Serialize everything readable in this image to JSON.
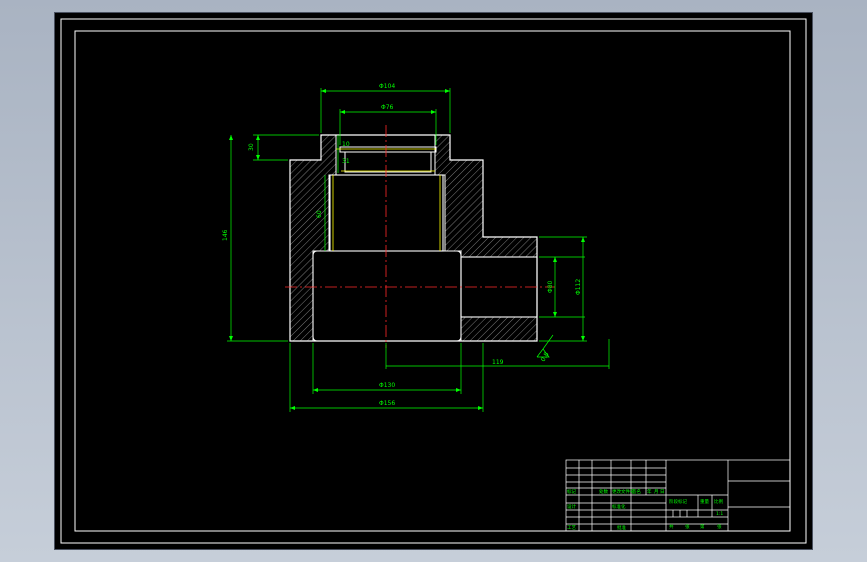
{
  "drawing": {
    "dimensions": {
      "top_outer_dia": "Φ104",
      "top_inner_dia": "Φ76",
      "left_small_height": "30",
      "overall_height": "146",
      "small_step_1": "10",
      "small_step_2": "31",
      "inner_step": "60",
      "bottom_bore_dia": "Φ130",
      "bottom_outer_dia": "Φ156",
      "right_inner_dia": "Φ80",
      "right_outer_dia": "Φ112",
      "right_length": "119",
      "surface_mark": "0.8"
    },
    "title_block": {
      "table_cells": [
        "标记",
        "处数",
        "更改文件号",
        "签名",
        "年",
        "月",
        "日"
      ],
      "designer": "设计",
      "process": "工艺",
      "standardization": "标准化",
      "approval": "批准",
      "stage_mark": "阶段标记",
      "weight": "重量",
      "scale": "比例",
      "scale_value": "1:1",
      "sheet_total": "共",
      "sheet_label": "张",
      "sheet_no": "第",
      "sheet_label2": "张"
    }
  }
}
